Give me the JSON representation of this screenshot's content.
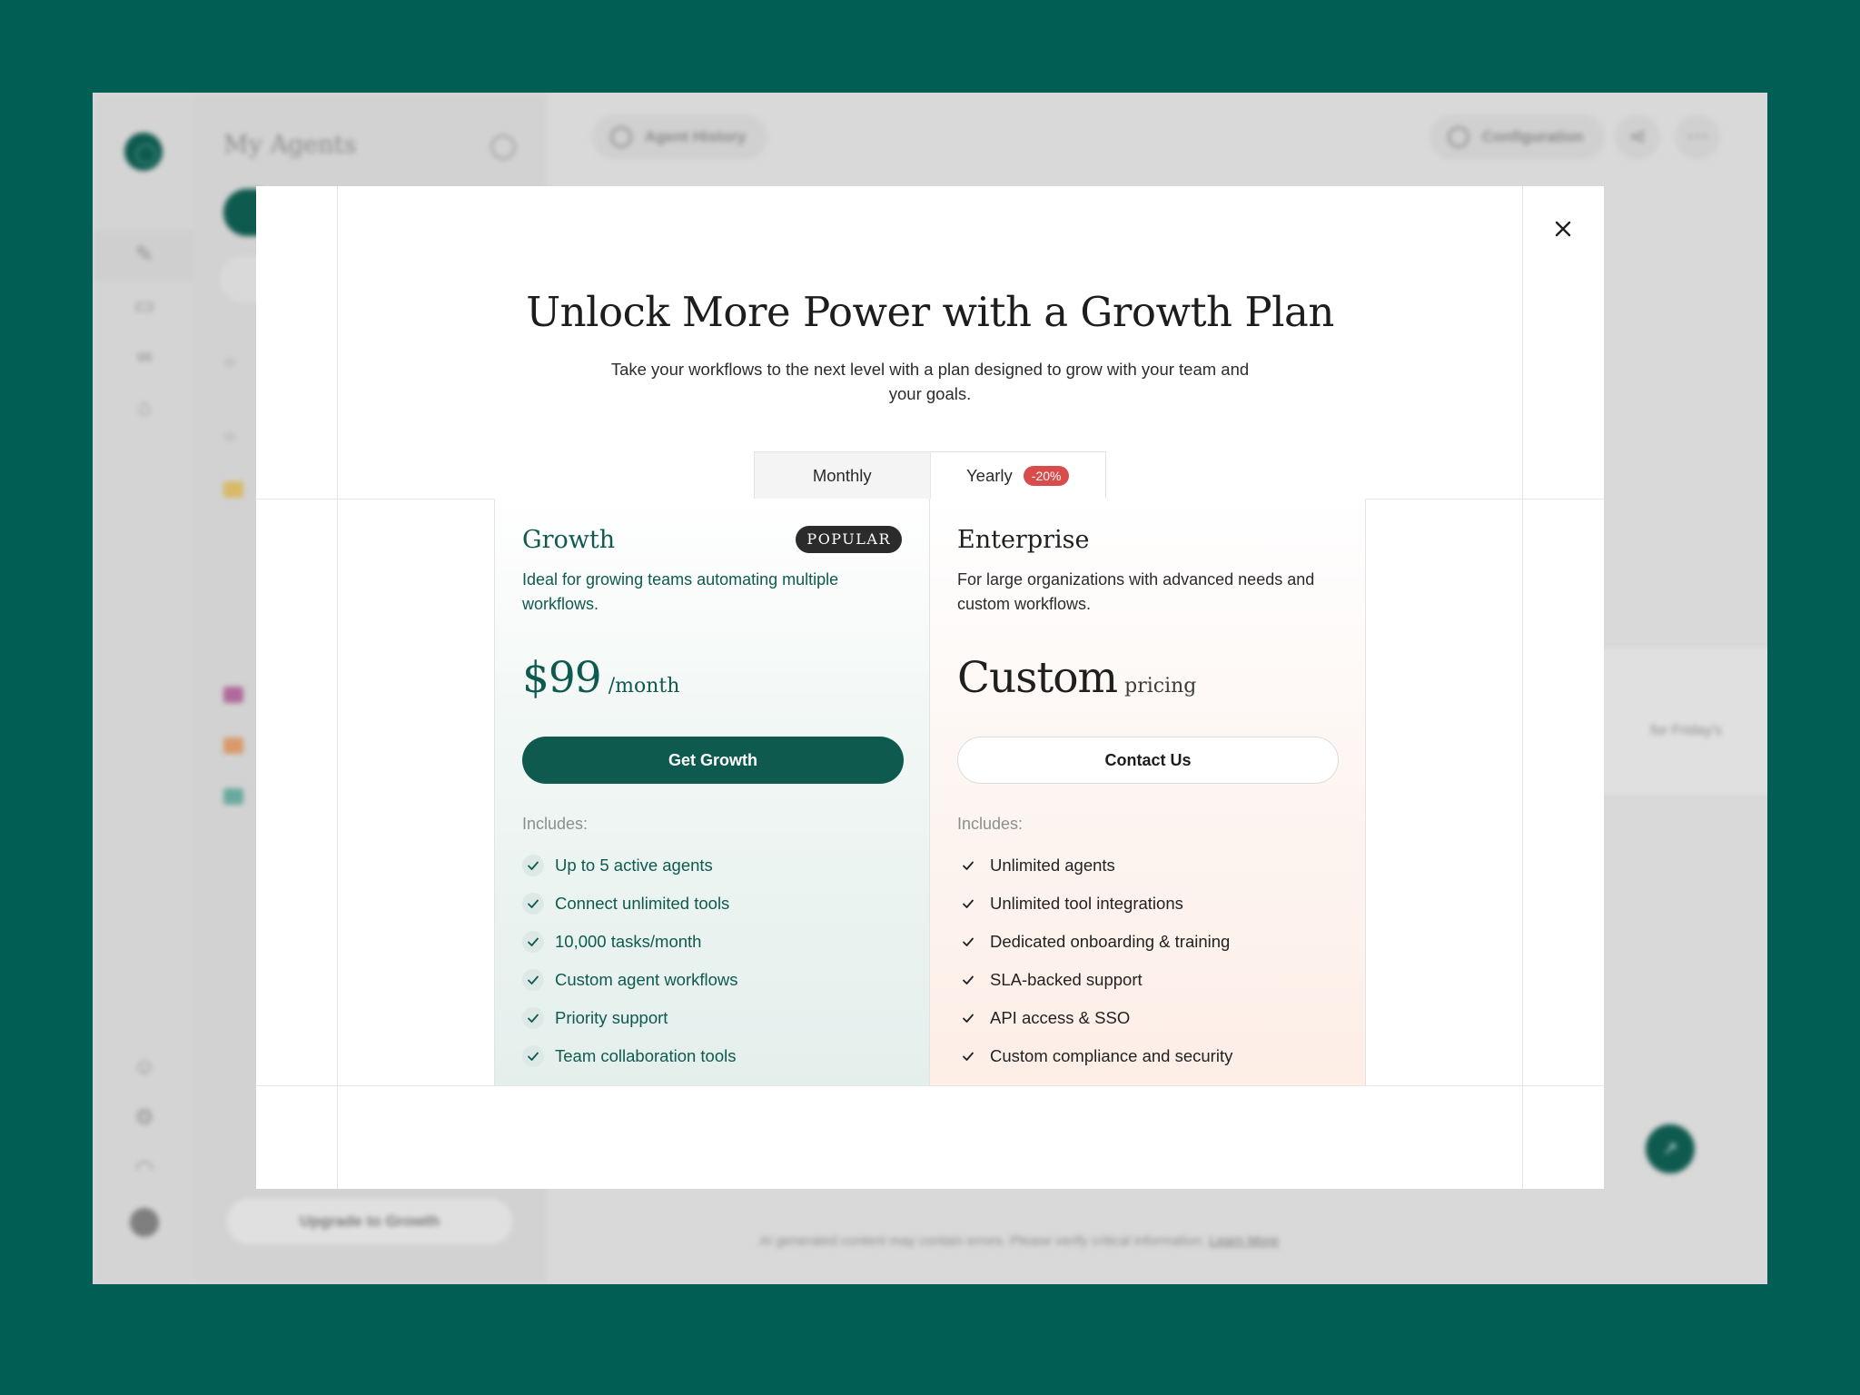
{
  "background_app": {
    "sidebar_title": "My Agents",
    "topbar": {
      "history_label": "Agent History",
      "config_label": "Configuration"
    },
    "upgrade_label": "Upgrade to Growth",
    "card_snippet": "for Friday's",
    "footer_note": "AI generated content may contain errors. Please verify critical information.",
    "footer_link": "Learn More",
    "rail_icons": [
      "pencil-icon",
      "book-icon",
      "link-icon",
      "bank-icon",
      "user-icon",
      "gear-icon",
      "headset-icon"
    ]
  },
  "modal": {
    "title": "Unlock More Power with a Growth Plan",
    "subtitle": "Take your workflows to the next level with a plan designed to grow with your team and your goals.",
    "billing_toggle": {
      "monthly_label": "Monthly",
      "yearly_label": "Yearly",
      "yearly_discount": "-20%",
      "selected": "Monthly"
    },
    "plans": {
      "growth": {
        "name": "Growth",
        "badge": "POPULAR",
        "description": "Ideal for growing teams automating multiple workflows.",
        "price": "$99",
        "price_unit": "/month",
        "cta": "Get Growth",
        "includes_label": "Includes:",
        "features": [
          "Up to 5 active agents",
          "Connect unlimited tools",
          "10,000 tasks/month",
          "Custom agent workflows",
          "Priority support",
          "Team collaboration tools"
        ]
      },
      "enterprise": {
        "name": "Enterprise",
        "description": "For large organizations with advanced needs and custom workflows.",
        "price": "Custom",
        "price_unit": "pricing",
        "cta": "Contact Us",
        "includes_label": "Includes:",
        "features": [
          "Unlimited agents",
          "Unlimited tool integrations",
          "Dedicated onboarding & training",
          "SLA-backed support",
          "API access & SSO",
          "Custom compliance and security"
        ]
      }
    }
  },
  "colors": {
    "page_background": "#015e55",
    "brand_green": "#0f5a4f",
    "discount_red": "#d94c4c",
    "badge_dark": "#2b2b2b"
  }
}
